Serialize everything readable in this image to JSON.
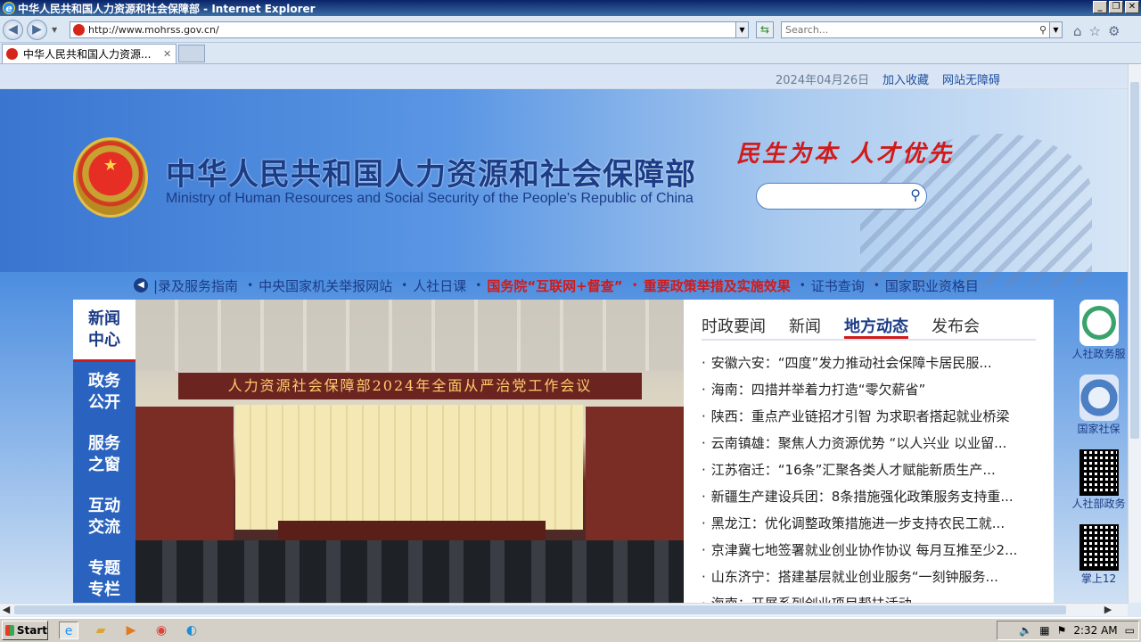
{
  "window": {
    "title": "中华人民共和国人力资源和社会保障部 - Internet Explorer",
    "min_label": "_",
    "max_label": "❐",
    "close_label": "✕"
  },
  "addressbar": {
    "url": "http://www.mohrss.gov.cn/",
    "search_placeholder": "Search..."
  },
  "tabs": [
    {
      "label": "中华人民共和国人力资源..."
    }
  ],
  "page": {
    "date": "2024年04月26日",
    "link_favorite": "加入收藏",
    "link_accessible": "网站无障碍",
    "title_cn": "中华人民共和国人力资源和社会保障部",
    "title_en": "Ministry of Human Resources and Social Security of the People's Republic of China",
    "slogan": "民生为本 人才优先",
    "marquee": [
      {
        "text": "|录及服务指南",
        "highlight": false
      },
      {
        "text": "中央国家机关举报网站",
        "highlight": false
      },
      {
        "text": "人社日课",
        "highlight": false
      },
      {
        "text": "国务院“互联网+督查”",
        "highlight": true
      },
      {
        "text": "重要政策举措及实施效果",
        "highlight": true
      },
      {
        "text": "证书查询",
        "highlight": false
      },
      {
        "text": "国家职业资格目",
        "highlight": false
      }
    ],
    "leftnav": [
      {
        "line1": "新闻",
        "line2": "中心",
        "active": true
      },
      {
        "line1": "政务",
        "line2": "公开",
        "active": false
      },
      {
        "line1": "服务",
        "line2": "之窗",
        "active": false
      },
      {
        "line1": "互动",
        "line2": "交流",
        "active": false
      },
      {
        "line1": "专题",
        "line2": "专栏",
        "active": false
      }
    ],
    "photo_banner": "人力资源社会保障部2024年全面从严治党工作会议",
    "news_tabs": [
      "时政要闻",
      "新闻",
      "地方动态",
      "发布会"
    ],
    "news_active_tab": 2,
    "news_items": [
      "安徽六安：“四度”发力推动社会保障卡居民服...",
      "海南：四措并举着力打造“零欠薪省”",
      "陕西：重点产业链招才引智 为求职者搭起就业桥梁",
      "云南镇雄：聚焦人力资源优势 “以人兴业 以业留...",
      "江苏宿迁：“16条”汇聚各类人才赋能新质生产...",
      "新疆生产建设兵团：8条措施强化政策服务支持重...",
      "黑龙江：优化调整政策措施进一步支持农民工就...",
      "京津冀七地签署就业创业协作协议 每月互推至少2...",
      "山东济宁：搭建基层就业创业服务“一刻钟服务...",
      "海南：开展系列创业项目帮扶活动"
    ],
    "right_widgets": [
      "人社政务服",
      "国家社保",
      "人社部政务",
      "掌上12"
    ]
  },
  "taskbar": {
    "start_label": "Start",
    "clock": "2:32 AM"
  },
  "colors": {
    "brand_blue": "#1b3c86",
    "accent_red": "#d11a1a"
  }
}
